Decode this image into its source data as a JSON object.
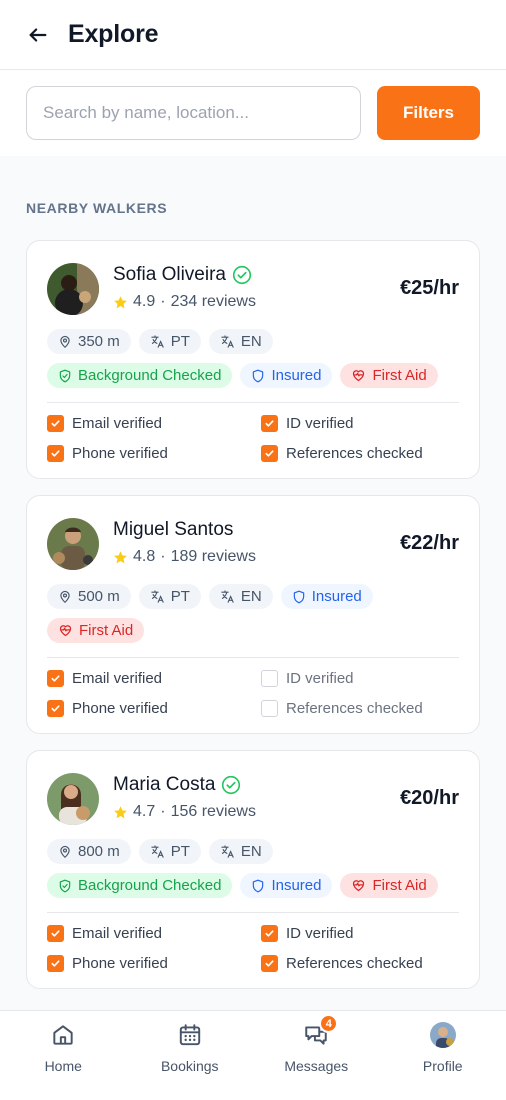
{
  "header": {
    "title": "Explore"
  },
  "search": {
    "placeholder": "Search by name, location...",
    "value": "",
    "filters_label": "Filters"
  },
  "section": {
    "label": "NEARBY WALKERS"
  },
  "walkers": [
    {
      "name": "Sofia Oliveira",
      "verified": true,
      "rating": "4.9",
      "reviews": "234 reviews",
      "price": "€25/hr",
      "distance": "350 m",
      "languages": [
        "PT",
        "EN"
      ],
      "badges": {
        "background_checked": "Background Checked",
        "insured": "Insured",
        "first_aid": "First Aid"
      },
      "checks": {
        "email": "Email verified",
        "id": "ID verified",
        "phone": "Phone verified",
        "references": "References checked"
      },
      "check_state": {
        "email": true,
        "id": true,
        "phone": true,
        "references": true
      }
    },
    {
      "name": "Miguel Santos",
      "verified": false,
      "rating": "4.8",
      "reviews": "189 reviews",
      "price": "€22/hr",
      "distance": "500 m",
      "languages": [
        "PT",
        "EN"
      ],
      "badges": {
        "insured": "Insured",
        "first_aid": "First Aid"
      },
      "checks": {
        "email": "Email verified",
        "id": "ID verified",
        "phone": "Phone verified",
        "references": "References checked"
      },
      "check_state": {
        "email": true,
        "id": false,
        "phone": true,
        "references": false
      }
    },
    {
      "name": "Maria Costa",
      "verified": true,
      "rating": "4.7",
      "reviews": "156 reviews",
      "price": "€20/hr",
      "distance": "800 m",
      "languages": [
        "PT",
        "EN"
      ],
      "badges": {
        "background_checked": "Background Checked",
        "insured": "Insured",
        "first_aid": "First Aid"
      },
      "checks": {
        "email": "Email verified",
        "id": "ID verified",
        "phone": "Phone verified",
        "references": "References checked"
      },
      "check_state": {
        "email": true,
        "id": true,
        "phone": true,
        "references": true
      }
    }
  ],
  "nav": {
    "home": "Home",
    "bookings": "Bookings",
    "messages": "Messages",
    "messages_badge": "4",
    "profile": "Profile"
  },
  "colors": {
    "accent": "#f97316",
    "verified": "#22c55e",
    "star": "#facc15"
  }
}
